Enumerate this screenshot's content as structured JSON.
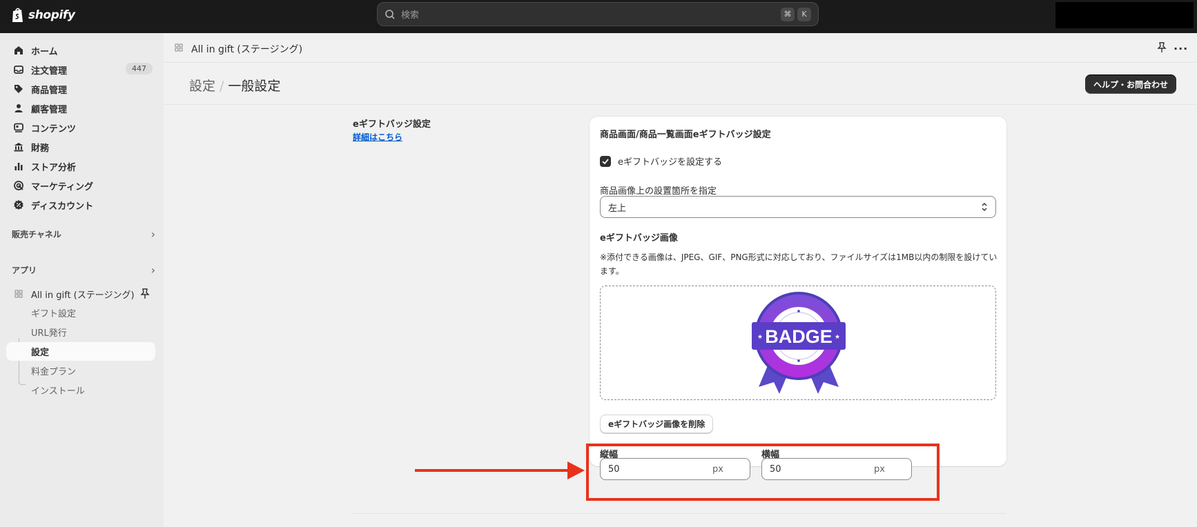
{
  "topbar": {
    "brand": "shopify",
    "search_placeholder": "検索",
    "shortcut_keys": [
      "⌘",
      "K"
    ]
  },
  "sidebar": {
    "items": [
      {
        "label": "ホーム",
        "icon": "home-icon"
      },
      {
        "label": "注文管理",
        "icon": "inbox-icon",
        "badge": "447"
      },
      {
        "label": "商品管理",
        "icon": "tag-icon"
      },
      {
        "label": "顧客管理",
        "icon": "person-icon"
      },
      {
        "label": "コンテンツ",
        "icon": "content-icon"
      },
      {
        "label": "財務",
        "icon": "bank-icon"
      },
      {
        "label": "ストア分析",
        "icon": "bar-chart-icon"
      },
      {
        "label": "マーケティング",
        "icon": "target-icon"
      },
      {
        "label": "ディスカウント",
        "icon": "discount-icon"
      }
    ],
    "sales_channels_label": "販売チャネル",
    "apps_label": "アプリ",
    "app_name": "All in gift (ステージング)",
    "app_subitems": [
      "ギフト設定",
      "URL発行",
      "設定",
      "料金プラン",
      "インストール"
    ],
    "active_subitem": "設定"
  },
  "appbar": {
    "title": "All in gift (ステージング)"
  },
  "page": {
    "breadcrumb_parent": "設定",
    "breadcrumb_current": "一般設定",
    "help_button": "ヘルプ・お問合わせ"
  },
  "section": {
    "title": "eギフトバッジ設定",
    "link": "詳細はこちら",
    "card_title": "商品画面/商品一覧画面eギフトバッジ設定",
    "checkbox_label": "eギフトバッジを設定する",
    "checkbox_checked": true,
    "position_label": "商品画像上の設置箇所を指定",
    "position_value": "左上",
    "image_title": "eギフトバッジ画像",
    "image_note": "※添付できる画像は、JPEG、GIF、PNG形式に対応しており、ファイルサイズは1MB以内の制限を設けています。",
    "badge_text": "BADGE",
    "delete_button": "eギフトバッジ画像を削除",
    "height_label": "縦幅",
    "height_value": "50",
    "width_label": "横幅",
    "width_value": "50",
    "unit": "px"
  },
  "colors": {
    "topbar": "#1a1a1a",
    "accent_link": "#005bd3",
    "annotation_red": "#e8321c",
    "badge_purple": "#7b3fe4"
  }
}
